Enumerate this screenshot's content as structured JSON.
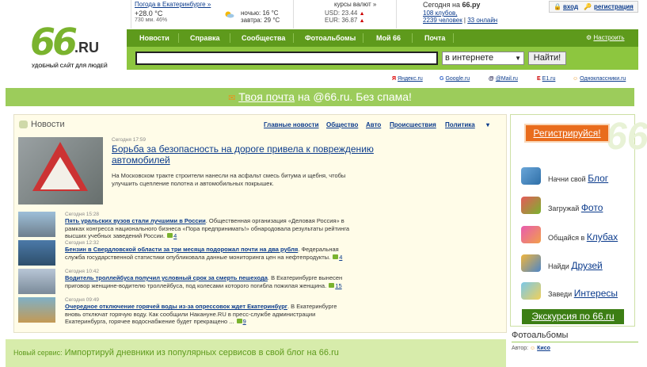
{
  "topbar": {
    "weather_link": "Погода в Екатеринбурге »",
    "temp_now": "+28.0 °C",
    "pressure_humidity": "730 мм. 46%",
    "night": "ночью: 16 °C",
    "tomorrow": "завтра: 29 °C",
    "currency_title": "курсы валют »",
    "usd": "USD: 23.44",
    "eur": "EUR: 36.87",
    "today_prefix": "Сегодня на",
    "today_site": "66.ру",
    "clubs": "108 клубов,",
    "people": "2239 человек",
    "online": "33 онлайн",
    "login": "вход",
    "register": "регистрация"
  },
  "logo": {
    "num": "66",
    "ru": ".RU",
    "slogan": "УДОБНЫЙ САЙТ ДЛЯ ЛЮДЕЙ"
  },
  "nav": {
    "items": [
      "Новости",
      "Справка",
      "Сообщества",
      "Фотоальбомы",
      "Мой 66",
      "Почта"
    ],
    "settings": "Настроить сайт"
  },
  "search": {
    "value": "",
    "scope": "в интернете",
    "button": "Найти!"
  },
  "engines": [
    "Яндекс.ru",
    "Google.ru",
    "@Mail.ru",
    "E1.ru",
    "Одноклассники.ru"
  ],
  "mail_banner": {
    "link": "Твоя почта",
    "rest": "на @66.ru. Без спама!"
  },
  "news": {
    "title": "Новости",
    "categories": [
      "Главные новости",
      "Общество",
      "Авто",
      "Происшествия",
      "Политика"
    ],
    "main": {
      "date": "Сегодня 17:59",
      "headline": "Борьба за безопасность на дороге привела к повреждению автомобилей",
      "text": "На Московском тракте строители нанесли на асфальт смесь битума и щебня, чтобы улучшить сцепление полотна и автомобильных покрышек."
    },
    "items": [
      {
        "date": "Сегодня 15:28",
        "headline": "Пять уральских вузов стали лучшими в России",
        "text": ". Общественная организация «Деловая Россия» в рамках конгресса национального бизнеса «Пора предпринимать!» обнародовала результаты рейтинга высших учебных заведений России.",
        "comments": "4"
      },
      {
        "date": "Сегодня 12:32",
        "headline": "Бензин в Свердловской области за три месяца подорожал почти на два рубля",
        "text": ". Федеральная служба государственной статистики опубликовала данные мониторинга цен на нефтепродукты.",
        "comments": "4"
      },
      {
        "date": "Сегодня 10:42",
        "headline": "Водитель троллейбуса получил условный срок за смерть пешехода",
        "text": ". В Екатеринбурге вынесен приговор женщине-водителю троллейбуса, под колесами которого погибла пожилая женщина.",
        "comments": "15"
      },
      {
        "date": "Сегодня 09:49",
        "headline": "Очередное отключение горячей воды из-за опрессовок ждет Екатеринбург",
        "text": ". В Екатеринбурге вновь отключат горячую воду. Как сообщили Накануне.RU в пресс-службе администрации Екатеринбурга, горячее водоснабжение будет прекращено ...",
        "comments": "9"
      }
    ]
  },
  "service": {
    "label": "Новый сервис:",
    "text": "Импортируй дневники из популярных сервисов в свой блог на 66.ru"
  },
  "right": {
    "register": "Регистрируйся!",
    "items": [
      {
        "pre": "Начни свой",
        "link": "Блог"
      },
      {
        "pre": "Загружай",
        "link": "Фото"
      },
      {
        "pre": "Общайся в",
        "link": "Клубах"
      },
      {
        "pre": "Найди",
        "link": "Друзей"
      },
      {
        "pre": "Заведи",
        "link": "Интересы"
      }
    ],
    "excursion": "Экскурсия по 66.ru",
    "photos_title": "Фотоальбомы",
    "author_label": "Автор:",
    "author": "Кисо"
  },
  "colors": {
    "brand_green": "#5e9a1c",
    "light_green": "#8dc63f",
    "orange": "#e96c1d",
    "link": "#0b3b8c"
  }
}
